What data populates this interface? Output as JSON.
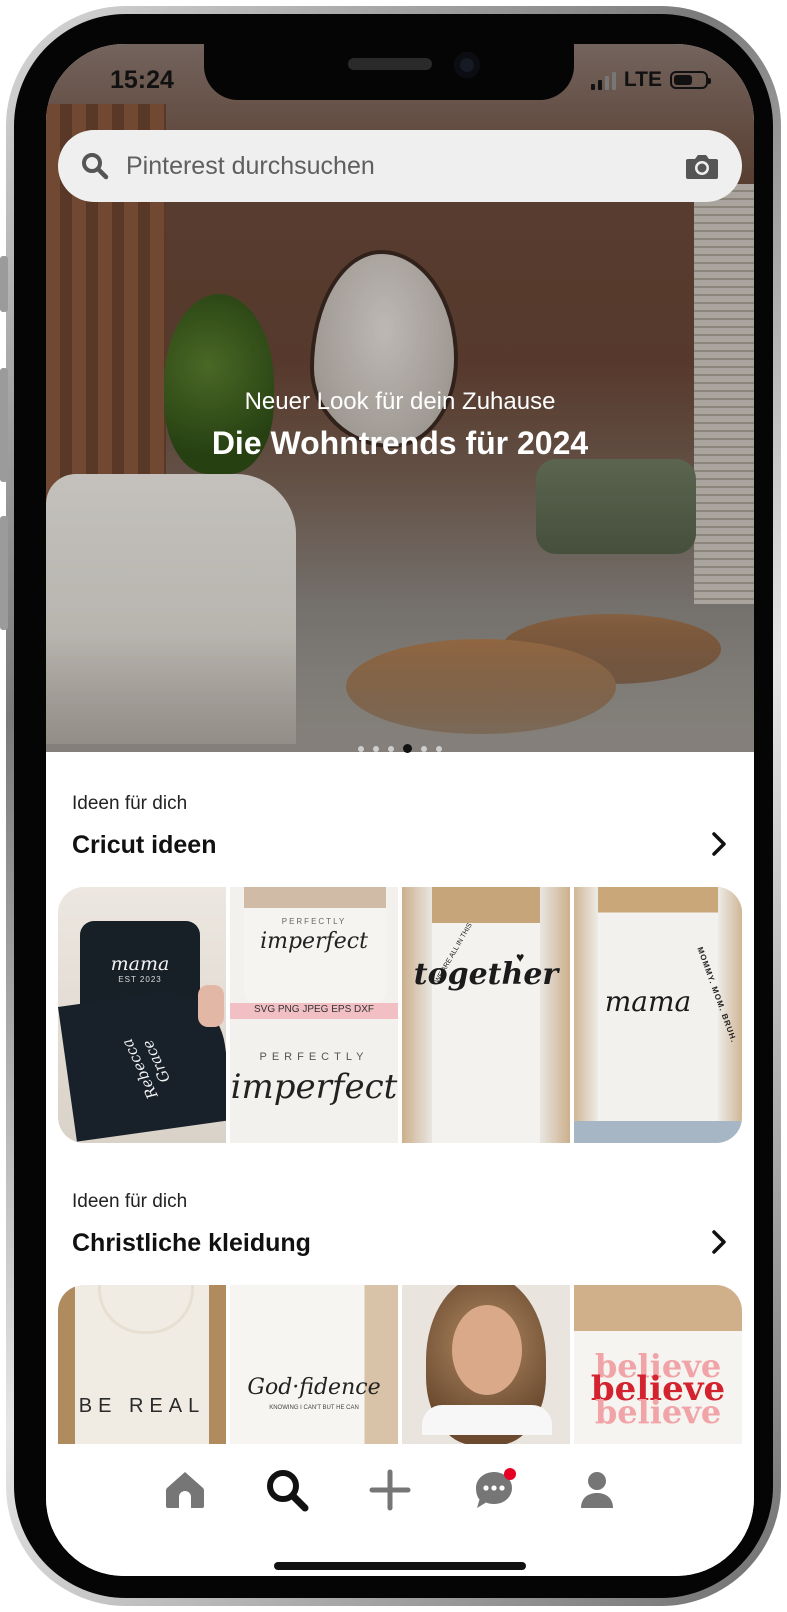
{
  "status_bar": {
    "time": "15:24",
    "network": "LTE",
    "battery_level": 0.6
  },
  "search": {
    "placeholder": "Pinterest durchsuchen"
  },
  "hero": {
    "subtitle": "Neuer Look für dein Zuhause",
    "title": "Die Wohntrends für 2024",
    "page_count": 6,
    "active_page": 4
  },
  "sections": [
    {
      "kicker": "Ideen für dich",
      "title": "Cricut ideen",
      "tiles": [
        {
          "caption": "mama",
          "sub": "EST 2023",
          "sleeve": "Rebecca Grace"
        },
        {
          "caption_top": "PERFECTLY",
          "caption_script": "imperfect",
          "formats": "SVG PNG JPEG EPS DXF",
          "caption_bottom": "PERFECTLY",
          "caption_big": "imperfect"
        },
        {
          "arc": "WE ARE ALL IN THIS",
          "caption": "together"
        },
        {
          "arc": "MOMMY. MOM. BRUH.",
          "caption": "mama"
        }
      ]
    },
    {
      "kicker": "Ideen für dich",
      "title": "Christliche kleidung",
      "tiles": [
        {
          "caption": "BE REAL"
        },
        {
          "caption": "God·fidence",
          "sub": "KNOWING I CAN'T BUT HE CAN"
        },
        {
          "caption": ""
        },
        {
          "caption": "believe"
        }
      ]
    }
  ],
  "nav": {
    "items": [
      "home-icon",
      "search-icon",
      "plus-icon",
      "chat-icon",
      "profile-icon"
    ],
    "active": "search-icon",
    "accent": "#e60023"
  }
}
